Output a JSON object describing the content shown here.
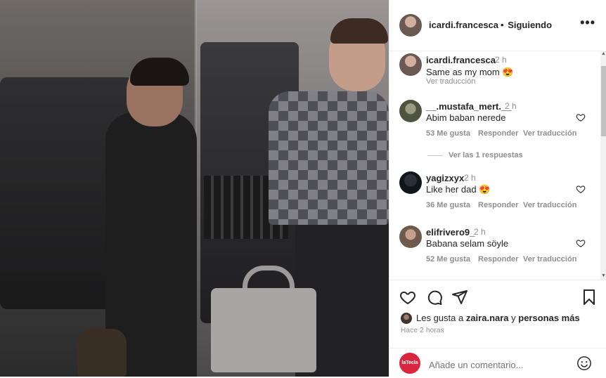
{
  "header": {
    "username": "icardi.francesca",
    "separator": "•",
    "follow_status": "Siguiendo",
    "more": "•••"
  },
  "caption": {
    "username": "icardi.francesca",
    "time": "2 h",
    "text": "Same as my mom 😍",
    "translate": "Ver traducción"
  },
  "comments": [
    {
      "username": "__.mustafa_mert.__",
      "time": "2 h",
      "text": "Abim baban nerede",
      "likes": "53 Me gusta",
      "reply": "Responder",
      "translate": "Ver traducción"
    },
    {
      "username": "yagizxyx",
      "time": "2 h",
      "text": "Like her dad 😍",
      "likes": "36 Me gusta",
      "reply": "Responder",
      "translate": "Ver traducción"
    },
    {
      "username": "elifrivero9_",
      "time": "2 h",
      "text": "Babana selam söyle",
      "likes": "52 Me gusta",
      "reply": "Responder",
      "translate": "Ver traducción"
    }
  ],
  "view_replies": "Ver las 1 respuestas",
  "likes": {
    "prefix": "Les gusta a ",
    "user": "zaira.nara",
    "middle": " y ",
    "suffix": "personas más"
  },
  "time_ago": "Hace 2 horas",
  "add_comment": {
    "avatar_text": "laTecla",
    "placeholder": "Añade un comentario..."
  }
}
